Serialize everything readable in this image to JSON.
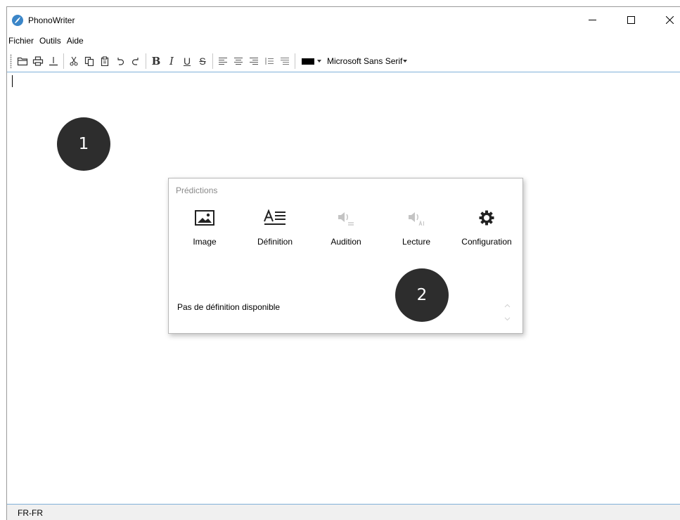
{
  "window": {
    "title": "PhonoWriter",
    "controls": [
      "minimize-icon",
      "maximize-icon",
      "close-icon"
    ]
  },
  "menu": {
    "items": [
      {
        "label": "Fichier"
      },
      {
        "label": "Outils"
      },
      {
        "label": "Aide"
      }
    ]
  },
  "toolbar": {
    "buttons": [
      "open-icon",
      "print-icon",
      "export-icon",
      "cut-icon",
      "copy-icon",
      "paste-icon",
      "undo-icon",
      "redo-icon"
    ],
    "format": {
      "bold": "B",
      "italic": "I",
      "underline": "U",
      "strike": "S"
    },
    "align": [
      "align-left-icon",
      "align-center-icon",
      "align-right-icon",
      "line-spacing-icon",
      "paragraph-spacing-icon"
    ],
    "text_color": "#000000",
    "font_name": "Microsoft Sans Serif"
  },
  "callouts": {
    "one": "1",
    "two": "2"
  },
  "predictions_panel": {
    "title": "Prédictions",
    "buttons": [
      {
        "label": "Image",
        "icon": "image-icon",
        "enabled": true
      },
      {
        "label": "Définition",
        "icon": "definition-icon",
        "enabled": true
      },
      {
        "label": "Audition",
        "icon": "audition-speaker-icon",
        "enabled": false
      },
      {
        "label": "Lecture",
        "icon": "lecture-speaker-icon",
        "enabled": false
      },
      {
        "label": "Configuration",
        "icon": "gear-icon",
        "enabled": true
      }
    ],
    "definition_text": "Pas de définition disponible"
  },
  "statusbar": {
    "language": "FR-FR"
  },
  "colors": {
    "accent_line": "#7fb0d8",
    "callout_bg": "#2d2d2d",
    "disabled_icon": "#c4c4c4",
    "app_icon": "#3b86c8"
  }
}
